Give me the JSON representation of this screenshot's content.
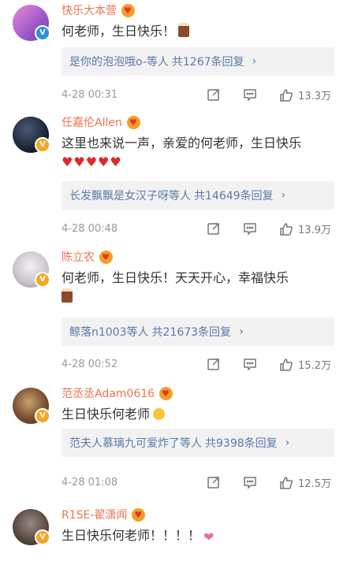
{
  "comments": [
    {
      "username": "快乐大本营",
      "text": "何老师，生日快乐！",
      "emoji": "cake-emoji",
      "reply_prefix": "是你的泡泡哦o-等人",
      "reply_count": "共1267条回复",
      "time": "4-28 00:31",
      "likes": "13.3万",
      "avatar_color": "#c06bc8",
      "badge": "blue"
    },
    {
      "username": "任嘉伦Allen",
      "text": "这里也来说一声，亲爱的何老师，生日快乐",
      "emoji": "heart-emoji",
      "hearts": "♥♥♥♥♥",
      "reply_prefix": "长发飘飘是女汉子呀等人",
      "reply_count": "共14649条回复",
      "time": "4-28 00:48",
      "likes": "13.9万",
      "avatar_color": "#1f2a3a",
      "badge": "gold"
    },
    {
      "username": "陈立农",
      "text": "何老师，生日快乐！天天开心，幸福快乐",
      "emoji": "cake-emoji",
      "reply_prefix": "鲸落n1003等人",
      "reply_count": "共21673条回复",
      "time": "4-28 00:52",
      "likes": "15.2万",
      "avatar_color": "#d9d9de",
      "badge": "gold"
    },
    {
      "username": "范丞丞Adam0616",
      "text": "生日快乐何老师",
      "emoji": "laugh-emoji",
      "reply_prefix": "范夫人慕璃九可爱炸了等人",
      "reply_count": "共9398条回复",
      "time": "4-28 01:08",
      "likes": "12.5万",
      "avatar_color": "#7a5a3a",
      "badge": "gold"
    },
    {
      "username": "R1SE-翟潇闻",
      "text": "生日快乐何老师！！！！",
      "emoji": "heart-emoji",
      "avatar_color": "#6b5a50",
      "badge": "gold"
    }
  ],
  "icons": {
    "forward": "forward-icon",
    "comment": "comment-icon",
    "like": "like-icon",
    "chevron": "chevron-right-icon",
    "verified": "verified-badge-icon",
    "crown": "vip-crown-icon"
  },
  "colors": {
    "username": "#eb7350",
    "reply_link": "#5a79a9",
    "meta": "#999999",
    "reply_bg": "#f2f2f2"
  }
}
